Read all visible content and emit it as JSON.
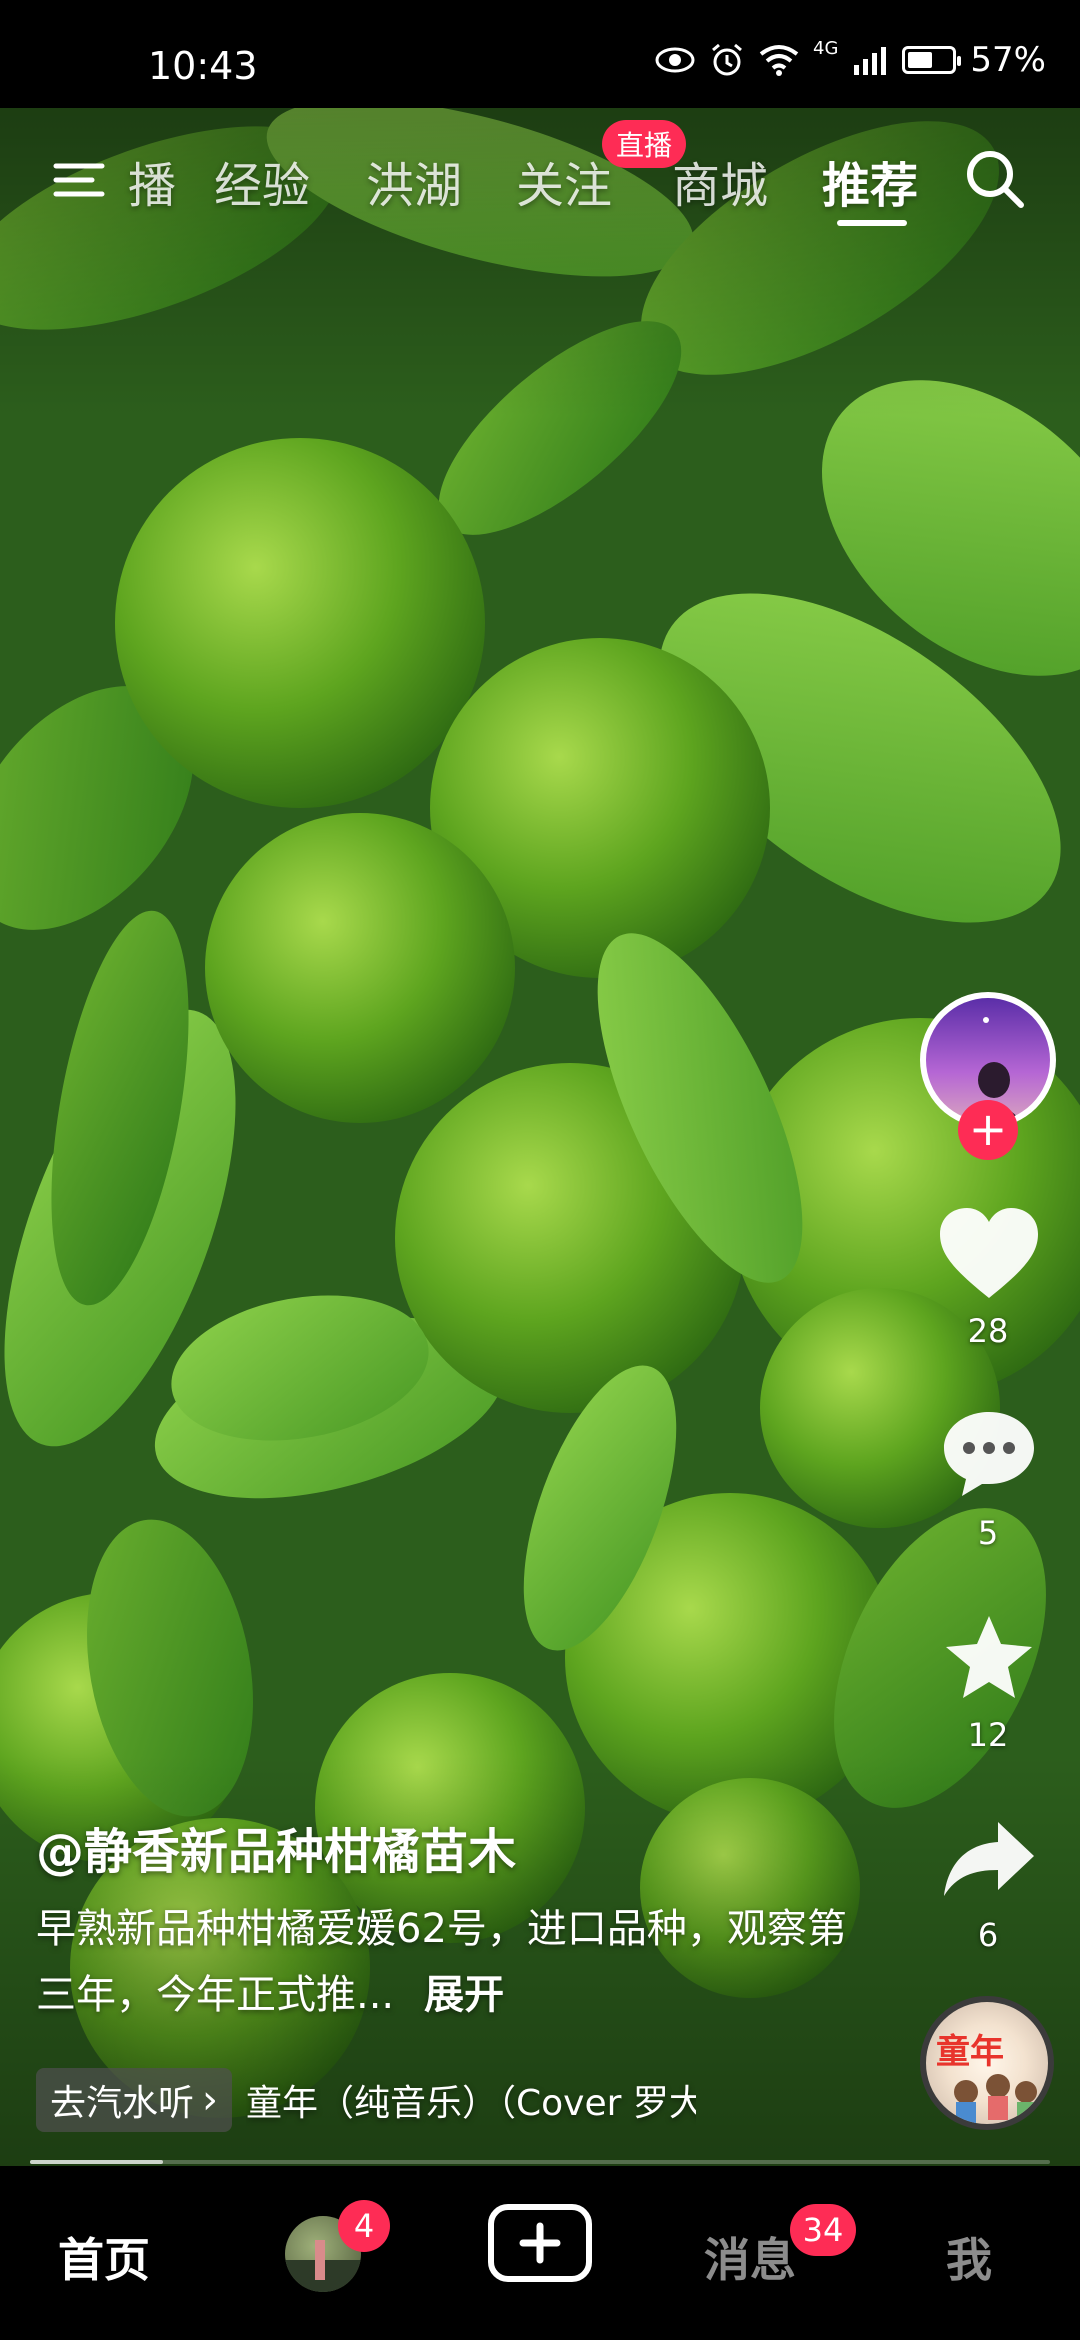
{
  "status": {
    "time": "10:43",
    "network": "4G",
    "battery": "57%",
    "battery_level": 0.57
  },
  "topnav": {
    "tabs": [
      "播",
      "经验",
      "洪湖",
      "关注",
      "商城",
      "推荐"
    ],
    "active_tab": "推荐",
    "live_badge": "直播"
  },
  "rail": {
    "likes": "28",
    "comments": "5",
    "favorites": "12",
    "shares": "6",
    "follow_symbol": "+"
  },
  "caption": {
    "author": "@静香新品种柑橘苗木",
    "description": "早熟新品种柑橘爱媛62号，进口品种，观察第三年，今年正式推...",
    "expand": "展开",
    "music_chip": "去汽水听",
    "music_chip_arrow": "›",
    "music_title": "童年（纯音乐）（Cover 罗大佑）",
    "disc_text": "童年"
  },
  "progress": 0.13,
  "bottombar": {
    "home": "首页",
    "friends_badge": "4",
    "messages": "消息",
    "messages_badge": "34",
    "me": "我"
  },
  "colors": {
    "accent": "#fe2c55",
    "background": "#000000"
  }
}
